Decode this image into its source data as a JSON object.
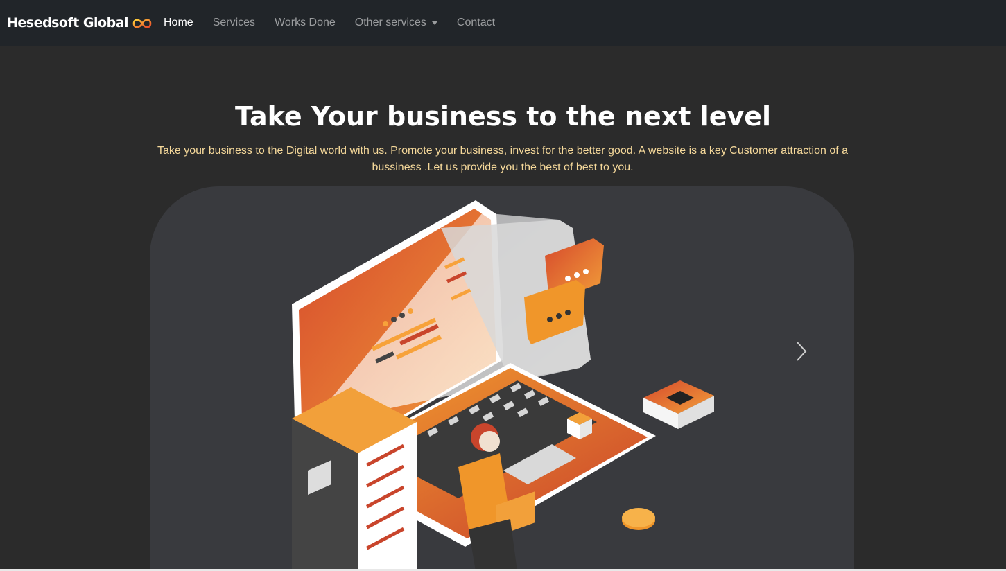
{
  "brand": {
    "name": "Hesedsoft Global",
    "logo_icon": "infinity-logo-icon"
  },
  "nav": {
    "items": [
      {
        "label": "Home",
        "active": true
      },
      {
        "label": "Services",
        "active": false
      },
      {
        "label": "Works Done",
        "active": false
      },
      {
        "label": "Other services",
        "active": false,
        "dropdown": true
      },
      {
        "label": "Contact",
        "active": false
      }
    ]
  },
  "hero": {
    "title": "Take Your business to the next level",
    "subtitle": "Take your business to the Digital world with us. Promote your business, invest for the better good. A website is a key Customer attraction of a bussiness .Let us provide you the best of best to you."
  },
  "carousel": {
    "next_icon": "chevron-right-icon",
    "illustration_icon": "laptop-server-isometric-illustration"
  },
  "colors": {
    "navbar_bg": "#212529",
    "page_bg": "#2b2b2b",
    "carousel_bg": "#393a3e",
    "accent_orange": "#f0962a",
    "accent_red": "#c9452c",
    "subtitle_text": "#f5d89a"
  }
}
